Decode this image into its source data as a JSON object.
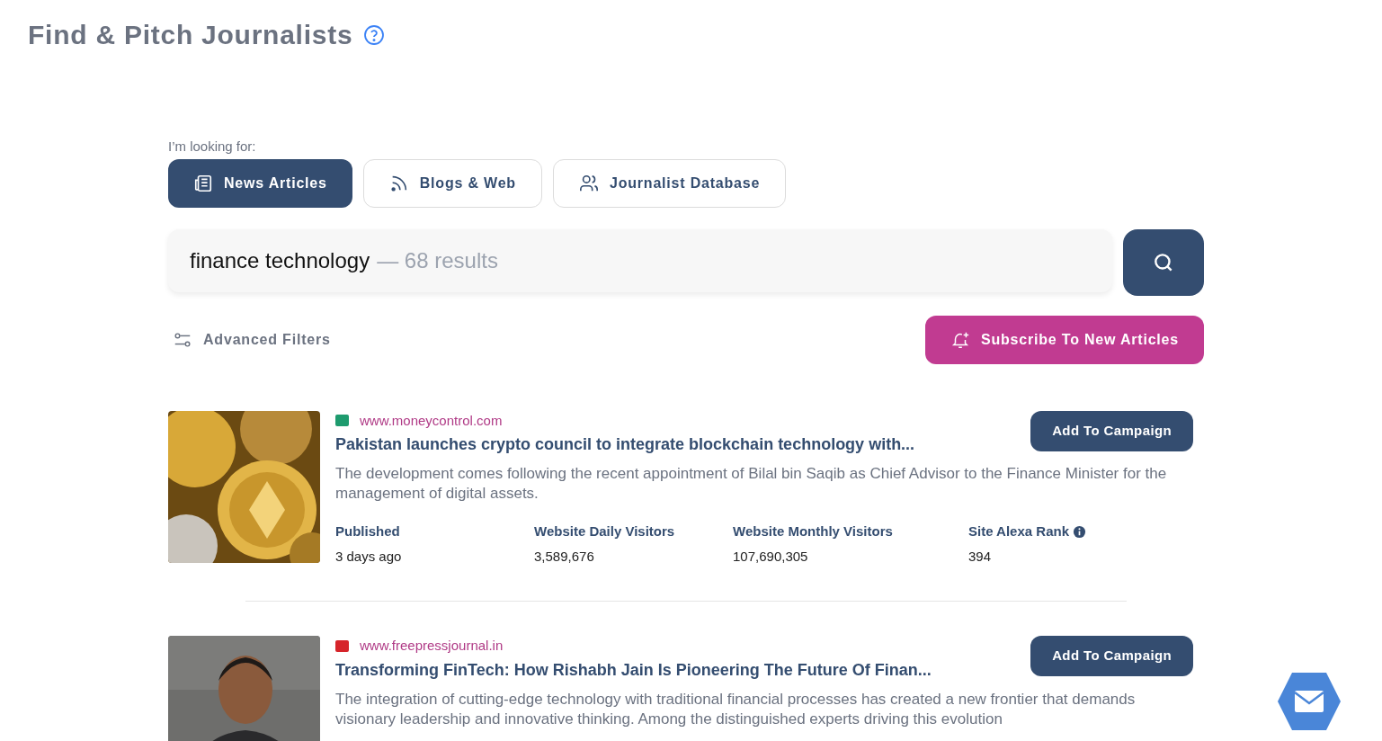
{
  "page_title": "Find & Pitch Journalists",
  "looking_for_label": "I’m looking for:",
  "tabs": [
    {
      "kind": "news",
      "label": "News Articles",
      "selected": true
    },
    {
      "kind": "blogs",
      "label": "Blogs & Web",
      "selected": false
    },
    {
      "kind": "journalists",
      "label": "Journalist Database",
      "selected": false
    }
  ],
  "search": {
    "value": "finance technology",
    "results": "— 68 results"
  },
  "advanced_filters": "Advanced Filters",
  "subscribe_button": "Subscribe To New Articles",
  "articles": [
    {
      "source": "www.moneycontrol.com",
      "title": "Pakistan launches crypto council to integrate blockchain technology with...",
      "description": "The development comes following the recent appointment of Bilal bin Saqib as Chief Advisor to the Finance Minister for the management of digital assets.",
      "button": "Add To Campaign",
      "stats": [
        {
          "label": "Published",
          "value": "3 days ago",
          "info": false
        },
        {
          "label": "Website Daily Visitors",
          "value": "3,589,676",
          "info": false
        },
        {
          "label": "Website Monthly Visitors",
          "value": "107,690,305",
          "info": false
        },
        {
          "label": "Site Alexa Rank",
          "value": "394",
          "info": true
        }
      ]
    },
    {
      "source": "www.freepressjournal.in",
      "title": "Transforming FinTech: How Rishabh Jain Is Pioneering The Future Of Finan...",
      "description": "The integration of cutting-edge technology with traditional financial processes has created a new frontier that demands visionary leadership and innovative thinking. Among the distinguished experts driving this evolution",
      "button": "Add To Campaign"
    }
  ]
}
